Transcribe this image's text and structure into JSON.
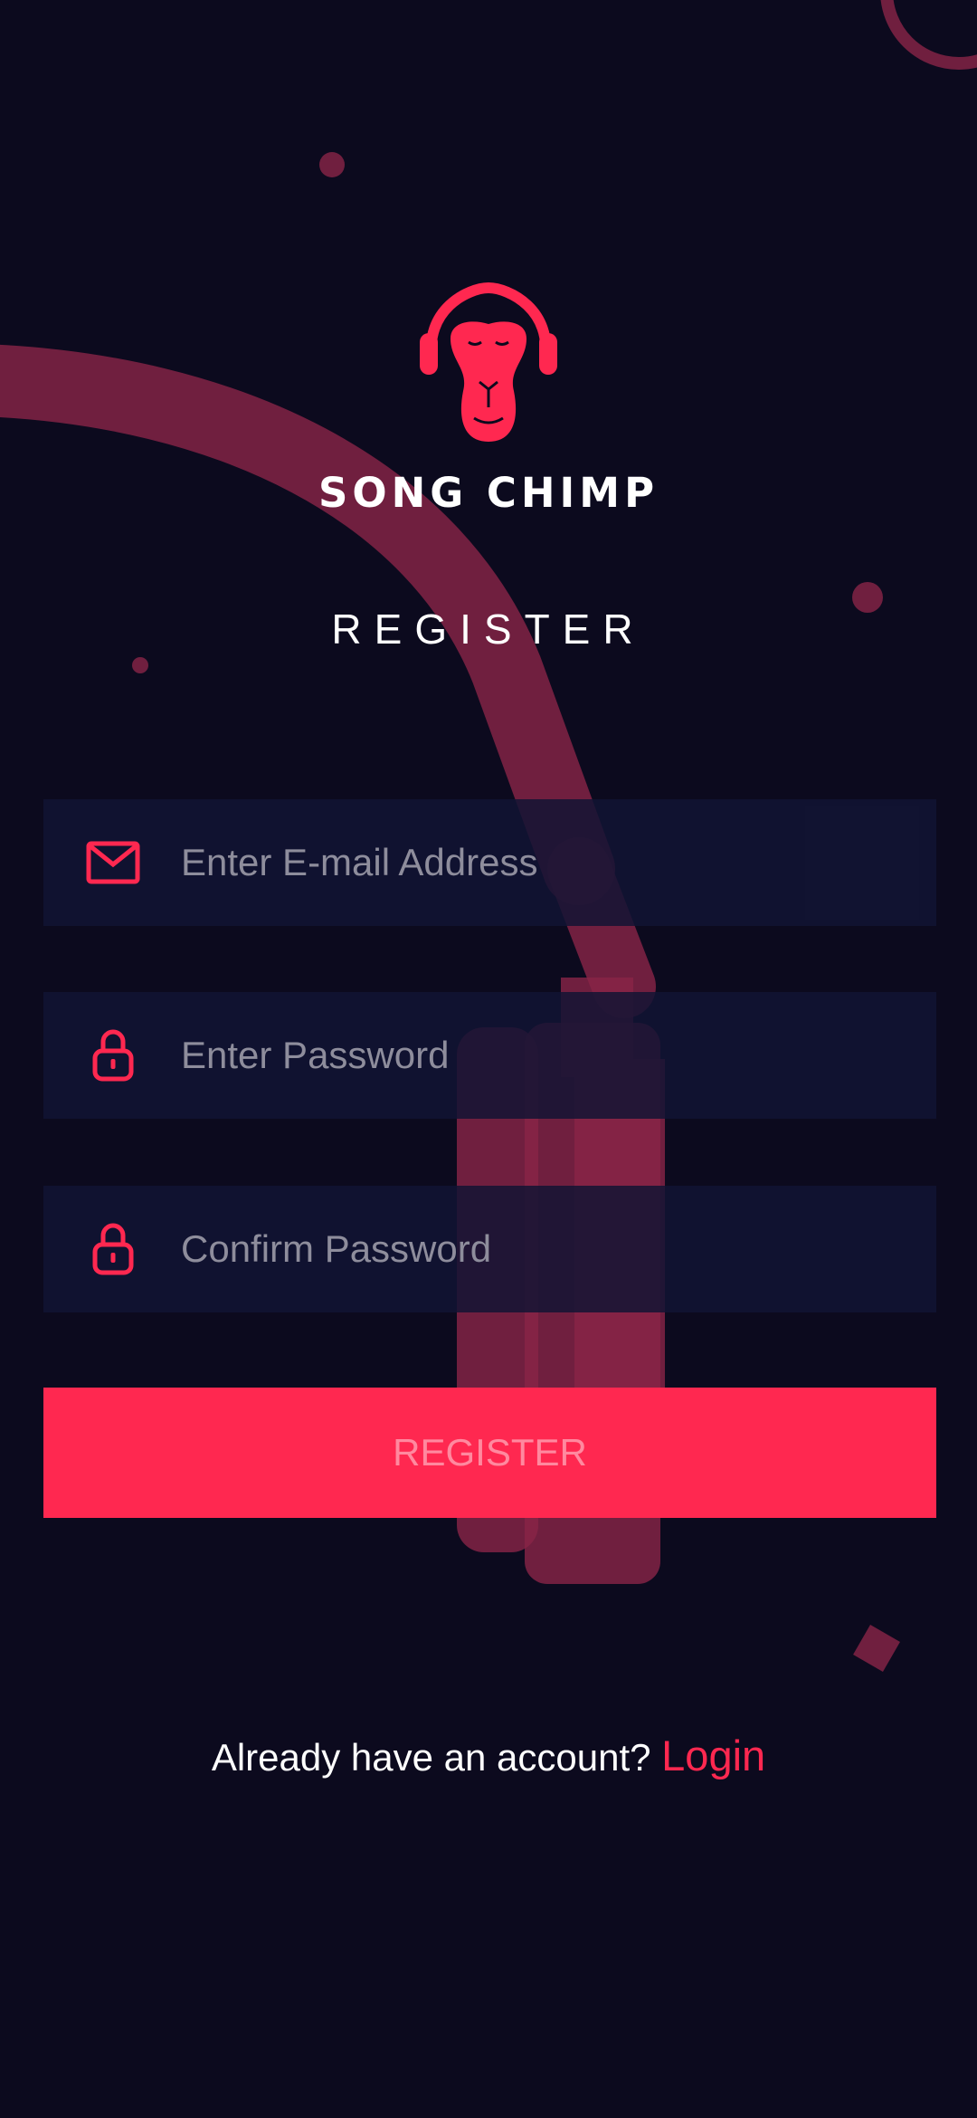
{
  "app": {
    "brand": "SONG CHIMP",
    "heading": "REGISTER"
  },
  "form": {
    "email": {
      "placeholder": "Enter E-mail Address",
      "value": "",
      "icon": "mail-icon"
    },
    "password": {
      "placeholder": "Enter Password",
      "value": "",
      "icon": "lock-icon"
    },
    "confirm_password": {
      "placeholder": "Confirm Password",
      "value": "",
      "icon": "lock-icon"
    },
    "submit_label": "REGISTER"
  },
  "footer": {
    "prompt": "Already have an account?",
    "link": "Login"
  },
  "colors": {
    "accent": "#ff2850",
    "background": "#0c0a1e",
    "field": "#12142f"
  }
}
